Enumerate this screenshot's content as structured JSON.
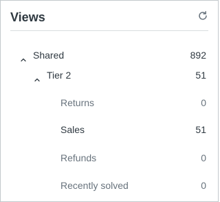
{
  "panel": {
    "title": "Views",
    "refresh_icon": "refresh-icon"
  },
  "tree": {
    "shared": {
      "label": "Shared",
      "count": "892",
      "icon": "chevron-up-icon"
    },
    "tier2": {
      "label": "Tier 2",
      "count": "51",
      "icon": "chevron-up-icon"
    },
    "items": [
      {
        "label": "Returns",
        "count": "0"
      },
      {
        "label": "Sales",
        "count": "51"
      },
      {
        "label": "Refunds",
        "count": "0"
      },
      {
        "label": "Recently solved",
        "count": "0"
      }
    ]
  }
}
